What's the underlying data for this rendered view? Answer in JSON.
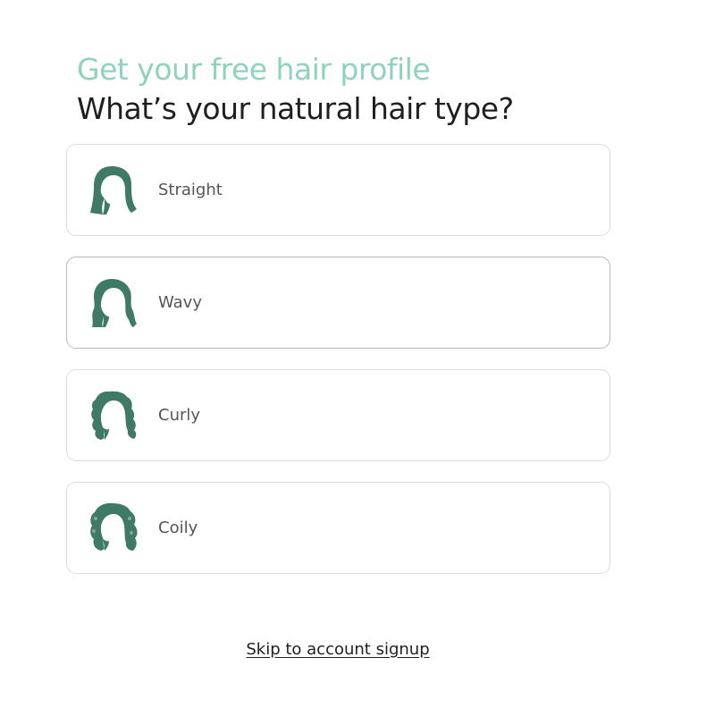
{
  "header": {
    "subtitle": "Get your free hair profile",
    "title": "What’s your natural hair type?"
  },
  "options": [
    {
      "label": "Straight",
      "icon": "straight-hair-icon"
    },
    {
      "label": "Wavy",
      "icon": "wavy-hair-icon"
    },
    {
      "label": "Curly",
      "icon": "curly-hair-icon"
    },
    {
      "label": "Coily",
      "icon": "coily-hair-icon"
    }
  ],
  "footer": {
    "skip_link": "Skip to account signup"
  },
  "colors": {
    "accent": "#8fd2bd",
    "icon_fill": "#3f7a66",
    "title": "#1f1f1f",
    "label": "#555555",
    "border": "#dcdcdc"
  }
}
